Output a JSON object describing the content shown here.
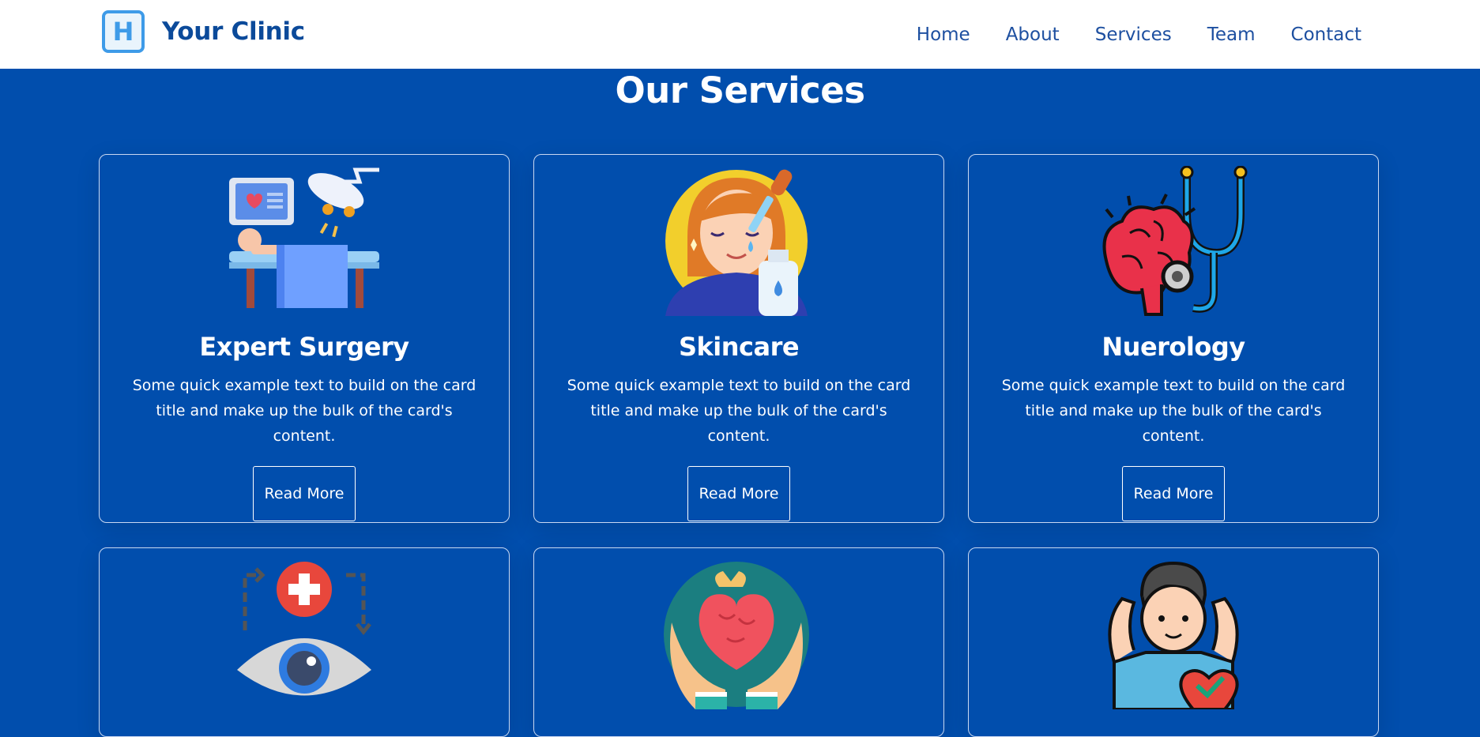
{
  "navbar": {
    "logo_letter": "H",
    "brand": "Your Clinic",
    "links": [
      "Home",
      "About",
      "Services",
      "Team",
      "Contact"
    ]
  },
  "services": {
    "title": "Our Services",
    "cards": [
      {
        "title": "Expert Surgery",
        "text": "Some quick example text to build on the card title and make up the bulk of the card's content.",
        "button": "Read More",
        "icon": "surgery-illustration"
      },
      {
        "title": "Skincare",
        "text": "Some quick example text to build on the card title and make up the bulk of the card's content.",
        "button": "Read More",
        "icon": "skincare-illustration"
      },
      {
        "title": "Nuerology",
        "text": "Some quick example text to build on the card title and make up the bulk of the card's content.",
        "button": "Read More",
        "icon": "brain-stethoscope-illustration"
      },
      {
        "icon": "eye-care-illustration"
      },
      {
        "icon": "heart-in-hands-illustration"
      },
      {
        "icon": "fitness-health-illustration"
      }
    ]
  },
  "colors": {
    "background": "#014ead",
    "navbar": "#ffffff",
    "brand_text": "#0b4a9a",
    "logo_accent": "#3e9be8"
  }
}
